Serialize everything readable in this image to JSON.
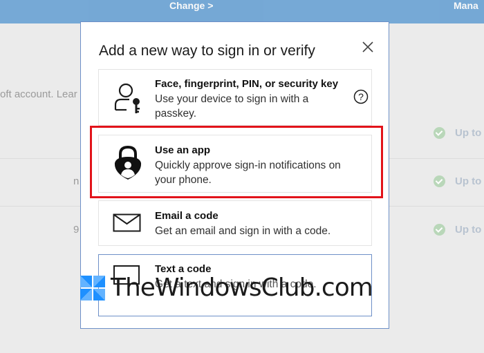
{
  "background": {
    "topbar_links": [
      "Change >",
      "Mana"
    ],
    "account_text": "oft account. Lear",
    "row_fragments": [
      "n",
      "9"
    ],
    "status_text": "Up to da"
  },
  "dialog": {
    "title": "Add a new way to sign in or verify",
    "options": [
      {
        "title": "Face, fingerprint, PIN, or security key",
        "description": "Use your device to sign in with a passkey.",
        "icon": "passkey-user-key-icon"
      },
      {
        "title": "Use an app",
        "description": "Quickly approve sign-in notifications on your phone.",
        "icon": "authenticator-app-lock-icon"
      },
      {
        "title": "Email a code",
        "description": "Get an email and sign in with a code.",
        "icon": "envelope-icon"
      },
      {
        "title": "Text a code",
        "description": "Get a text and sign in with a code.",
        "icon": "phone-message-icon"
      }
    ]
  },
  "watermark": {
    "text": "TheWindowsClub.com"
  },
  "colors": {
    "highlight": "#e2131a",
    "dialog_border": "#6d8fc7",
    "accent_blue": "#1e90ff"
  }
}
